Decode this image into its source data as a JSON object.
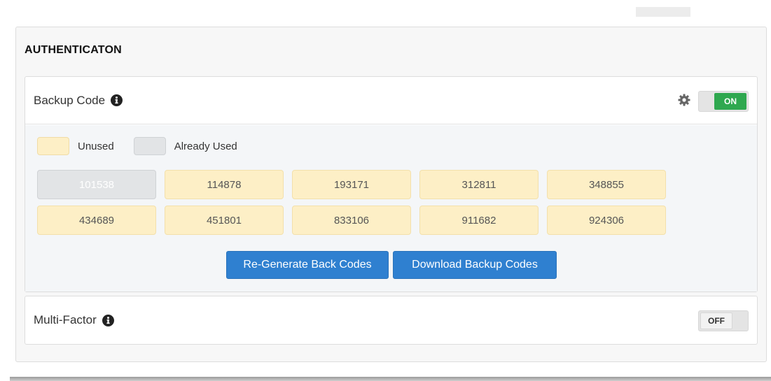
{
  "section": {
    "title": "AUTHENTICATON"
  },
  "backup": {
    "title": "Backup Code",
    "info_icon": "info-circle-icon",
    "settings_icon": "gear-icon",
    "toggle_label": "ON",
    "toggle_state": "on",
    "legend": {
      "unused_label": "Unused",
      "used_label": "Already Used"
    },
    "codes": [
      {
        "value": "101538",
        "status": "used"
      },
      {
        "value": "114878",
        "status": "unused"
      },
      {
        "value": "193171",
        "status": "unused"
      },
      {
        "value": "312811",
        "status": "unused"
      },
      {
        "value": "348855",
        "status": "unused"
      },
      {
        "value": "434689",
        "status": "unused"
      },
      {
        "value": "451801",
        "status": "unused"
      },
      {
        "value": "833106",
        "status": "unused"
      },
      {
        "value": "911682",
        "status": "unused"
      },
      {
        "value": "924306",
        "status": "unused"
      }
    ],
    "regenerate_label": "Re-Generate Back Codes",
    "download_label": "Download Backup Codes"
  },
  "mfa": {
    "title": "Multi-Factor",
    "info_icon": "info-circle-icon",
    "toggle_label": "OFF",
    "toggle_state": "off"
  },
  "colors": {
    "accent": "#2f80d0",
    "toggle_on": "#2fa84f",
    "unused_code": "#fdefc6",
    "used_code": "#e2e4e6"
  }
}
